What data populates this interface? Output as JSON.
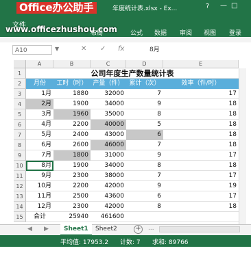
{
  "window": {
    "brand": "Office办公助手",
    "title_fragment": "年度统计表.xlsx - Ex...",
    "help": "?",
    "minimize": "—",
    "maximize": "□"
  },
  "ribbon": {
    "file_tab": "文件",
    "watermark": "www.officezhushou.com",
    "tabs": [
      "布局",
      "公式",
      "数据",
      "审阅",
      "视图",
      "登录"
    ]
  },
  "formula_bar": {
    "name_box": "A10",
    "fx": "fx",
    "value": "8月"
  },
  "columns": [
    "A",
    "B",
    "C",
    "D",
    "E"
  ],
  "rows": [
    "1",
    "2",
    "3",
    "4",
    "5",
    "6",
    "7",
    "8",
    "9",
    "10",
    "11",
    "12",
    "13",
    "14",
    "15"
  ],
  "sheet": {
    "title": "公司年度生产数量统计表",
    "headers": [
      "月份",
      "工时（时）",
      "产量（件）",
      "累计（次）",
      "效率（件/时）"
    ],
    "data": [
      {
        "month": "1月",
        "hours": "1880",
        "output": "32000",
        "count": "7",
        "eff": "17"
      },
      {
        "month": "2月",
        "hours": "1900",
        "output": "34000",
        "count": "9",
        "eff": "18"
      },
      {
        "month": "3月",
        "hours": "1960",
        "output": "35000",
        "count": "8",
        "eff": "18"
      },
      {
        "month": "4月",
        "hours": "2200",
        "output": "40000",
        "count": "5",
        "eff": "18"
      },
      {
        "month": "5月",
        "hours": "2400",
        "output": "43000",
        "count": "6",
        "eff": "18"
      },
      {
        "month": "6月",
        "hours": "2600",
        "output": "46000",
        "count": "7",
        "eff": "18"
      },
      {
        "month": "7月",
        "hours": "1800",
        "output": "31000",
        "count": "9",
        "eff": "17"
      },
      {
        "month": "8月",
        "hours": "1900",
        "output": "34000",
        "count": "8",
        "eff": "18"
      },
      {
        "month": "9月",
        "hours": "2300",
        "output": "38000",
        "count": "7",
        "eff": "17"
      },
      {
        "month": "10月",
        "hours": "2200",
        "output": "42000",
        "count": "9",
        "eff": "19"
      },
      {
        "month": "11月",
        "hours": "2500",
        "output": "43600",
        "count": "6",
        "eff": "17"
      },
      {
        "month": "12月",
        "hours": "2300",
        "output": "42000",
        "count": "8",
        "eff": "18"
      }
    ],
    "total_label": "合计",
    "total_hours": "25940",
    "total_output": "461600"
  },
  "tabs": {
    "sheet1": "Sheet1",
    "sheet2": "Sheet2",
    "add": "+",
    "more": "..."
  },
  "status": {
    "average": "平均值: 17953.2",
    "count": "计数: 7",
    "sum": "求和: 89766"
  },
  "colors": {
    "excel_green": "#217346",
    "header_blue": "#5aaedb",
    "highlight_gray": "#c8c8c8",
    "brand_red": "#d9332a"
  }
}
